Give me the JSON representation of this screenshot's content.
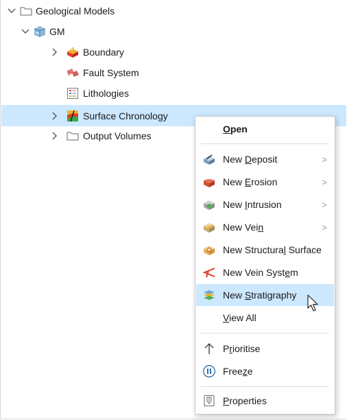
{
  "tree": {
    "items": [
      {
        "label": "Geological Models",
        "icon": "folder-icon"
      },
      {
        "label": "GM",
        "icon": "geomodel-icon"
      },
      {
        "label": "Boundary",
        "icon": "boundary-icon"
      },
      {
        "label": "Fault System",
        "icon": "fault-system-icon"
      },
      {
        "label": "Lithologies",
        "icon": "lithologies-icon"
      },
      {
        "label": "Surface Chronology",
        "icon": "surface-chronology-icon",
        "selected": true
      },
      {
        "label": "Output Volumes",
        "icon": "folder-icon"
      }
    ]
  },
  "context_menu": {
    "items": [
      {
        "pre": "",
        "key": "O",
        "post": "pen",
        "icon": "",
        "submenu": false
      },
      {
        "pre": "New ",
        "key": "D",
        "post": "eposit",
        "icon": "deposit-icon",
        "submenu": true
      },
      {
        "pre": "New ",
        "key": "E",
        "post": "rosion",
        "icon": "erosion-icon",
        "submenu": true
      },
      {
        "pre": "New ",
        "key": "I",
        "post": "ntrusion",
        "icon": "intrusion-icon",
        "submenu": true
      },
      {
        "pre": "New Vei",
        "key": "n",
        "post": "",
        "icon": "vein-icon",
        "submenu": true
      },
      {
        "pre": "New Structura",
        "key": "l",
        "post": " Surface",
        "icon": "structural-surface-icon",
        "submenu": false
      },
      {
        "pre": "New Vein Syst",
        "key": "e",
        "post": "m",
        "icon": "vein-system-icon",
        "submenu": false
      },
      {
        "pre": "New ",
        "key": "S",
        "post": "tratigraphy",
        "icon": "stratigraphy-icon",
        "submenu": false,
        "highlighted": true
      },
      {
        "pre": "",
        "key": "V",
        "post": "iew All",
        "icon": "",
        "submenu": false
      },
      {
        "pre": "P",
        "key": "r",
        "post": "ioritise",
        "icon": "arrow-up-icon",
        "submenu": false
      },
      {
        "pre": "Free",
        "key": "z",
        "post": "e",
        "icon": "pause-circle-icon",
        "submenu": false
      },
      {
        "pre": "",
        "key": "P",
        "post": "roperties",
        "icon": "properties-icon",
        "submenu": false
      }
    ],
    "submenu_arrow": ">"
  },
  "colors": {
    "selection": "#cce8ff",
    "chevron": "#555555"
  }
}
